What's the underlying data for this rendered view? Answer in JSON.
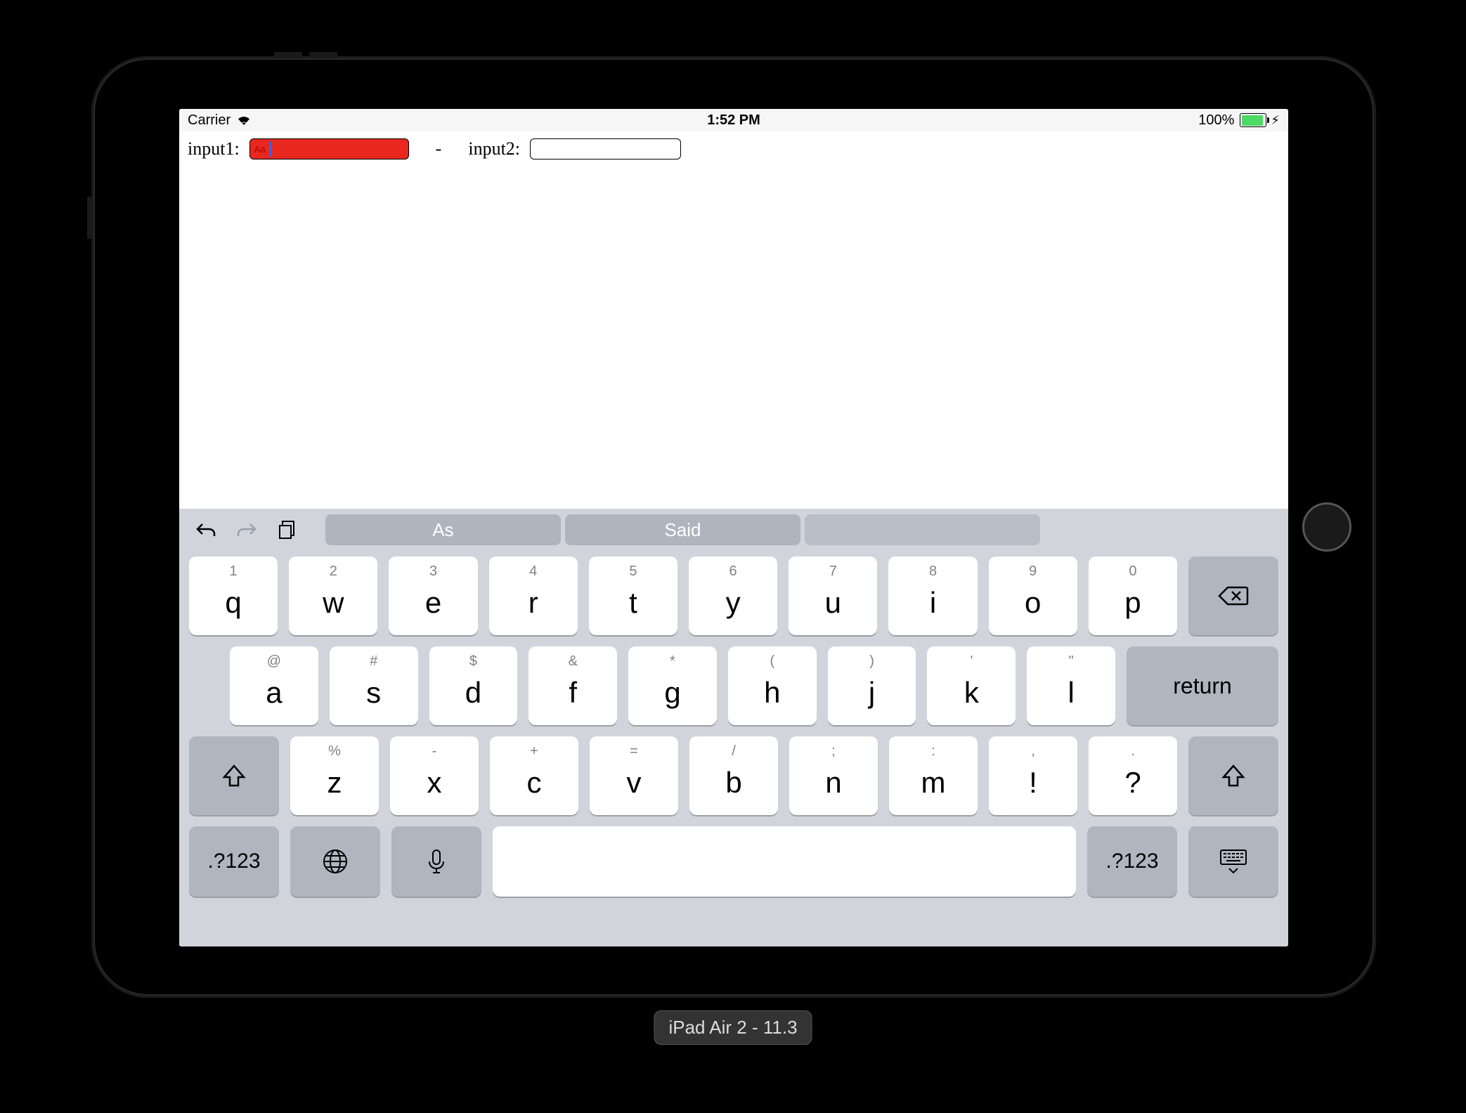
{
  "statusbar": {
    "carrier": "Carrier",
    "time": "1:52 PM",
    "battery": "100%"
  },
  "form": {
    "label1": "input1:",
    "value1": "Aa",
    "sep": "-",
    "label2": "input2:"
  },
  "kb": {
    "suggestions": [
      "As",
      "Said",
      ""
    ],
    "row1": [
      {
        "m": "q",
        "s": "1"
      },
      {
        "m": "w",
        "s": "2"
      },
      {
        "m": "e",
        "s": "3"
      },
      {
        "m": "r",
        "s": "4"
      },
      {
        "m": "t",
        "s": "5"
      },
      {
        "m": "y",
        "s": "6"
      },
      {
        "m": "u",
        "s": "7"
      },
      {
        "m": "i",
        "s": "8"
      },
      {
        "m": "o",
        "s": "9"
      },
      {
        "m": "p",
        "s": "0"
      }
    ],
    "row2": [
      {
        "m": "a",
        "s": "@"
      },
      {
        "m": "s",
        "s": "#"
      },
      {
        "m": "d",
        "s": "$"
      },
      {
        "m": "f",
        "s": "&"
      },
      {
        "m": "g",
        "s": "*"
      },
      {
        "m": "h",
        "s": "("
      },
      {
        "m": "j",
        "s": ")"
      },
      {
        "m": "k",
        "s": "'"
      },
      {
        "m": "l",
        "s": "\""
      }
    ],
    "row3": [
      {
        "m": "z",
        "s": "%"
      },
      {
        "m": "x",
        "s": "-"
      },
      {
        "m": "c",
        "s": "+"
      },
      {
        "m": "v",
        "s": "="
      },
      {
        "m": "b",
        "s": "/"
      },
      {
        "m": "n",
        "s": ";"
      },
      {
        "m": "m",
        "s": ":"
      },
      {
        "m": "!",
        "s": ","
      },
      {
        "m": "?",
        "s": "."
      }
    ],
    "return": "return",
    "mode": ".?123"
  },
  "device_label": "iPad Air 2 - 11.3"
}
